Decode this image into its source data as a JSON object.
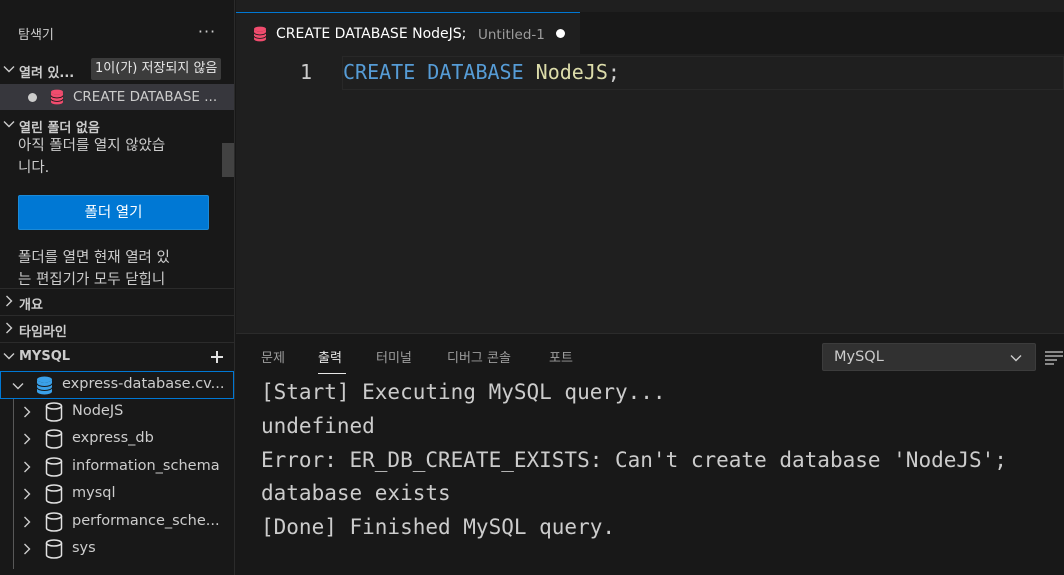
{
  "sidebar": {
    "title": "탐색기",
    "open_editors": {
      "label": "열려 있...",
      "badge": "1이(가) 저장되지 않음",
      "items": [
        {
          "label": "CREATE DATABASE ...",
          "dirty": true
        }
      ]
    },
    "no_folder": {
      "label": "열린 폴더 없음",
      "message_lines": [
        "아직 폴더를 열지 않았습",
        "니다."
      ],
      "open_folder_button": "폴더 열기",
      "note_lines": [
        "폴더를 열면 현재 열려 있",
        "는 편집기가 모두 닫힙니"
      ]
    },
    "outline": {
      "label": "개요"
    },
    "timeline": {
      "label": "타임라인"
    },
    "mysql": {
      "label": "MYSQL",
      "connection": "express-database.cv...",
      "databases": [
        "NodeJS",
        "express_db",
        "information_schema",
        "mysql",
        "performance_sche...",
        "sys"
      ]
    }
  },
  "editor": {
    "tab": {
      "title": "CREATE DATABASE NodeJS;",
      "description": "Untitled-1",
      "dirty": true
    },
    "lines": [
      {
        "number": "1",
        "tokens": {
          "kw1": "CREATE",
          "kw2": "DATABASE",
          "ident": "NodeJS",
          "punct": ";"
        }
      }
    ]
  },
  "panel": {
    "tabs": [
      "문제",
      "출력",
      "터미널",
      "디버그 콘솔",
      "포트"
    ],
    "active_tab": "출력",
    "channel": "MySQL",
    "output": [
      "[Start] Executing MySQL query...",
      "undefined",
      "Error: ER_DB_CREATE_EXISTS: Can't create database 'NodeJS';",
      "database exists",
      "[Done] Finished MySQL query."
    ]
  },
  "colors": {
    "accent": "#0078d4",
    "database_icon": "#f14c6e",
    "keyword": "#569cd6",
    "identifier": "#dcdcaa"
  }
}
